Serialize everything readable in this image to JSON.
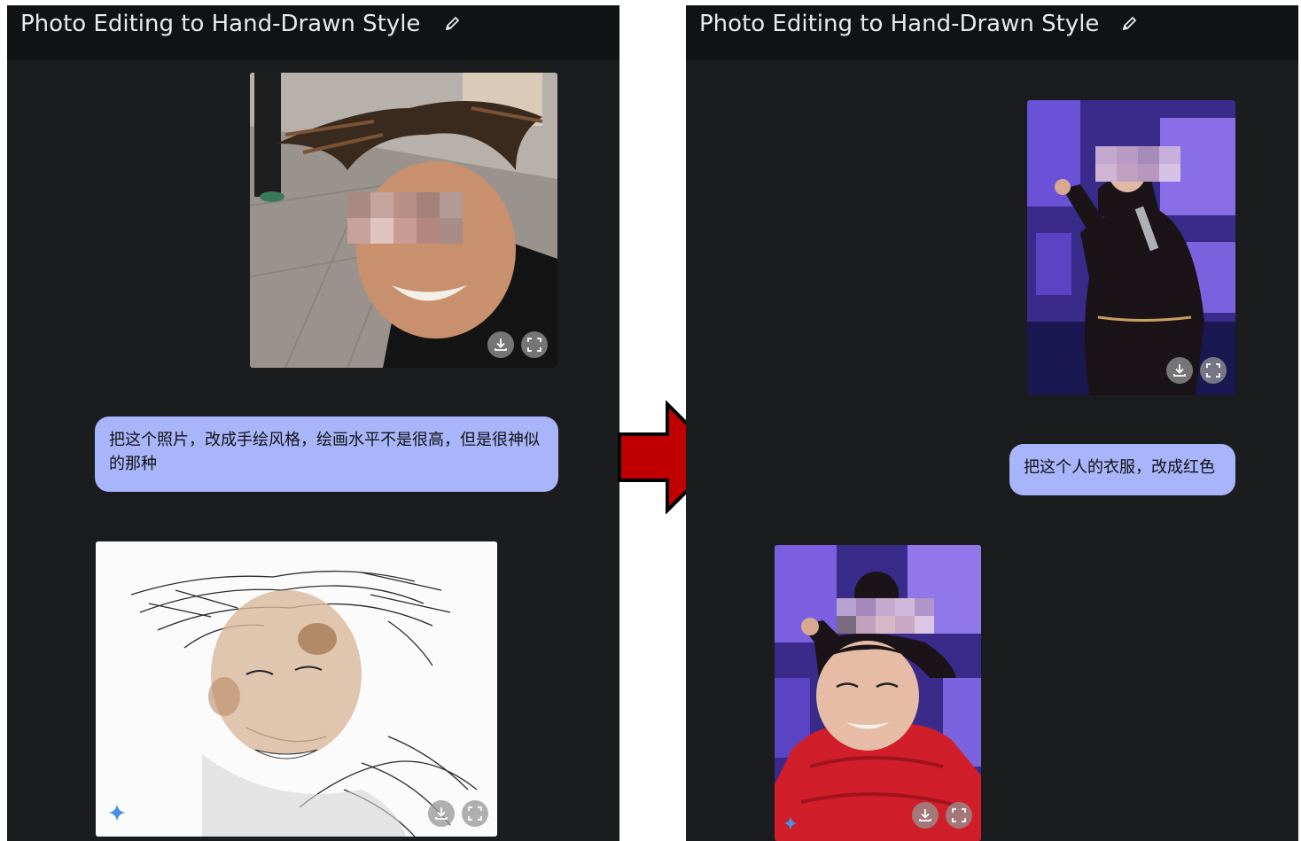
{
  "left_panel": {
    "title": "Photo Editing to Hand-Drawn Style",
    "prompt": "把这个照片，改成手绘风格，绘画水平不是很高，但是很神似的那种"
  },
  "right_panel": {
    "title": "Photo Editing to Hand-Drawn Style",
    "prompt": "把这个人的衣服，改成红色"
  },
  "colors": {
    "panel_bg": "#1b1c1e",
    "titlebar_bg": "#111214",
    "bubble_bg": "#a8b5fb",
    "arrow_fill": "#c00000",
    "sparkle": "#4a90e2"
  },
  "icons": [
    "pencil-icon",
    "download-icon",
    "fullscreen-icon",
    "sparkle-icon",
    "right-arrow"
  ]
}
